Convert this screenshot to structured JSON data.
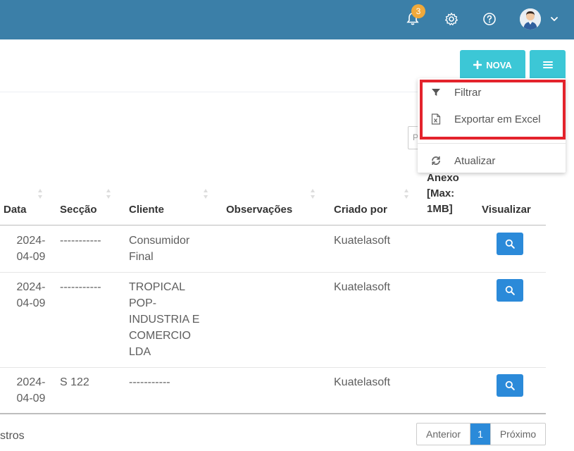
{
  "topbar": {
    "notification_count": "3",
    "icons": [
      "bell-icon",
      "gear-icon",
      "help-icon",
      "avatar",
      "chevron-down-icon"
    ]
  },
  "toolbar": {
    "nova_label": "NOVA",
    "search_placeholder_fragment": "P"
  },
  "menu": {
    "items": [
      {
        "label": "Filtrar",
        "icon": "filter-icon"
      },
      {
        "label": "Exportar em Excel",
        "icon": "excel-icon"
      },
      {
        "label": "Atualizar",
        "icon": "refresh-icon"
      }
    ]
  },
  "table": {
    "columns": [
      "Data",
      "Secção",
      "Cliente",
      "Observações",
      "Criado por",
      "Anexo [Max: 1MB]",
      "Visualizar"
    ],
    "rows": [
      {
        "data": "2024-\n04-09",
        "seccao": "-----------",
        "cliente": "Consumidor\nFinal",
        "observacoes": "",
        "criado_por": "Kuatelasoft"
      },
      {
        "data": "2024-\n04-09",
        "seccao": "-----------",
        "cliente": "TROPICAL\nPOP-\nINDUSTRIA E\nCOMERCIO\nLDA",
        "observacoes": "",
        "criado_por": "Kuatelasoft"
      },
      {
        "data": "2024-\n04-09",
        "seccao": "S 122",
        "cliente": "-----------",
        "observacoes": "",
        "criado_por": "Kuatelasoft"
      }
    ]
  },
  "footer": {
    "records_text": "stros",
    "pagination": {
      "prev": "Anterior",
      "current": "1",
      "next": "Próximo"
    }
  },
  "colors": {
    "topbar": "#3b7fa8",
    "accent": "#3cc7d6",
    "primary": "#2b8ad9",
    "highlight": "#e3232c",
    "badge": "#f0a93b"
  }
}
